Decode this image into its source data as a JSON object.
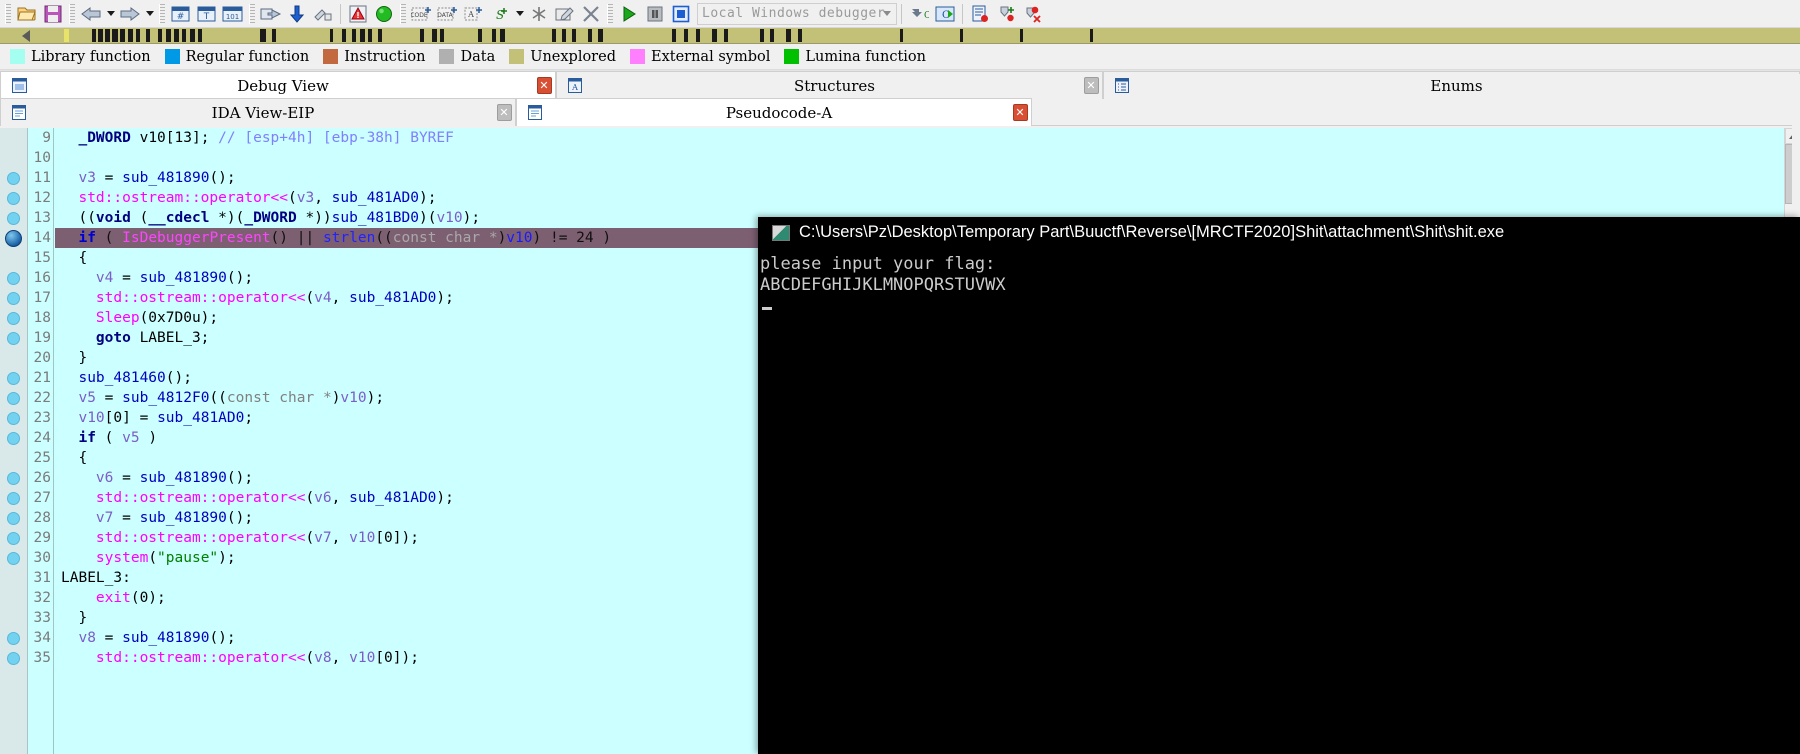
{
  "toolbar": {
    "debugger_combo_value": "Local Windows debugger",
    "buttons": [
      {
        "name": "open-file-icon",
        "glyph": "folder"
      },
      {
        "name": "save-icon",
        "glyph": "floppy"
      },
      {
        "name": "back-arrow-icon",
        "glyph": "left-arrow"
      },
      {
        "name": "back-history-dropdown-icon",
        "glyph": "caret"
      },
      {
        "name": "forward-arrow-icon",
        "glyph": "right-arrow"
      },
      {
        "name": "forward-history-dropdown-icon",
        "glyph": "caret"
      },
      {
        "name": "make-code-icon",
        "glyph": "code-hash"
      },
      {
        "name": "make-string-icon",
        "glyph": "text-T"
      },
      {
        "name": "make-data-icon",
        "glyph": "data-101"
      },
      {
        "name": "jump-to-operand-icon",
        "glyph": "jump"
      },
      {
        "name": "jump-down-icon",
        "glyph": "down-arrow"
      },
      {
        "name": "undefine-icon",
        "glyph": "undefine"
      },
      {
        "name": "warnings-icon",
        "glyph": "warning"
      },
      {
        "name": "run-icon",
        "glyph": "green-ball"
      },
      {
        "name": "add-code-icon",
        "glyph": "code-plus"
      },
      {
        "name": "add-data-icon",
        "glyph": "data-plus"
      },
      {
        "name": "add-ascii-icon",
        "glyph": "ascii-plus"
      },
      {
        "name": "add-struct-icon",
        "glyph": "struct-plus"
      },
      {
        "name": "struct-dropdown-icon",
        "glyph": "caret"
      },
      {
        "name": "unexplored-icon",
        "glyph": "asterisk"
      },
      {
        "name": "edit-icon",
        "glyph": "pencil-box"
      },
      {
        "name": "delete-icon",
        "glyph": "x-mark"
      },
      {
        "name": "debugger-start-icon",
        "glyph": "play"
      },
      {
        "name": "debugger-pause-icon",
        "glyph": "pause"
      },
      {
        "name": "debugger-stop-icon",
        "glyph": "stop"
      },
      {
        "name": "step-into-icon",
        "glyph": "step-into"
      },
      {
        "name": "step-over-icon",
        "glyph": "step-over"
      },
      {
        "name": "breakpoint-list-icon",
        "glyph": "bp-list"
      },
      {
        "name": "add-breakpoint-icon",
        "glyph": "bp-add"
      },
      {
        "name": "delete-breakpoint-icon",
        "glyph": "bp-del"
      }
    ]
  },
  "legend": {
    "items": [
      {
        "label": "Library function",
        "color": "#a5fff1"
      },
      {
        "label": "Regular function",
        "color": "#0099e6"
      },
      {
        "label": "Instruction",
        "color": "#c2693f"
      },
      {
        "label": "Data",
        "color": "#b0b0b0"
      },
      {
        "label": "Unexplored",
        "color": "#c3c177"
      },
      {
        "label": "External symbol",
        "color": "#ff7fff"
      },
      {
        "label": "Lumina function",
        "color": "#00c000"
      }
    ]
  },
  "tabs_top": [
    {
      "label": "Debug View",
      "active": true,
      "icon": "window-icon",
      "close": "red"
    },
    {
      "label": "Structures",
      "active": false,
      "icon": "struct-icon",
      "close": "grey"
    },
    {
      "label": "Enums",
      "active": false,
      "icon": "enum-icon",
      "close": "none"
    }
  ],
  "tabs_bottom": [
    {
      "label": "IDA View-EIP",
      "active": false,
      "icon": "page-icon",
      "close": "grey"
    },
    {
      "label": "Pseudocode-A",
      "active": true,
      "icon": "page-icon",
      "close": "red"
    }
  ],
  "code": {
    "highlighted_line": 14,
    "lines": [
      {
        "n": 9,
        "bp": false,
        "eip": false,
        "tokens": [
          {
            "t": "  ",
            "c": "plain"
          },
          {
            "t": "_DWORD",
            "c": "kw"
          },
          {
            "t": " v10[13]; ",
            "c": "plain"
          },
          {
            "t": "// [esp+4h] [ebp-38h] BYREF",
            "c": "cmt"
          }
        ]
      },
      {
        "n": 10,
        "bp": false,
        "eip": false,
        "tokens": []
      },
      {
        "n": 11,
        "bp": true,
        "eip": false,
        "tokens": [
          {
            "t": "  ",
            "c": "plain"
          },
          {
            "t": "v3",
            "c": "var"
          },
          {
            "t": " = ",
            "c": "plain"
          },
          {
            "t": "sub_481890",
            "c": "fn"
          },
          {
            "t": "();",
            "c": "plain"
          }
        ]
      },
      {
        "n": 12,
        "bp": true,
        "eip": false,
        "tokens": [
          {
            "t": "  ",
            "c": "plain"
          },
          {
            "t": "std::ostream::operator<<",
            "c": "api"
          },
          {
            "t": "(",
            "c": "plain"
          },
          {
            "t": "v3",
            "c": "var"
          },
          {
            "t": ", ",
            "c": "plain"
          },
          {
            "t": "sub_481AD0",
            "c": "fn"
          },
          {
            "t": ");",
            "c": "plain"
          }
        ]
      },
      {
        "n": 13,
        "bp": true,
        "eip": false,
        "tokens": [
          {
            "t": "  ((",
            "c": "plain"
          },
          {
            "t": "void",
            "c": "kw"
          },
          {
            "t": " (",
            "c": "plain"
          },
          {
            "t": "__cdecl",
            "c": "kw"
          },
          {
            "t": " *)(",
            "c": "plain"
          },
          {
            "t": "_DWORD",
            "c": "kw"
          },
          {
            "t": " *))",
            "c": "plain"
          },
          {
            "t": "sub_481BD0",
            "c": "fn"
          },
          {
            "t": ")(",
            "c": "plain"
          },
          {
            "t": "v10",
            "c": "var"
          },
          {
            "t": ");",
            "c": "plain"
          }
        ]
      },
      {
        "n": 14,
        "bp": false,
        "eip": true,
        "hl": true,
        "tokens": [
          {
            "t": "  ",
            "c": "plain"
          },
          {
            "t": "if",
            "c": "kw"
          },
          {
            "t": " ( ",
            "c": "plain"
          },
          {
            "t": "IsDebuggerPresent",
            "c": "api"
          },
          {
            "t": "() || ",
            "c": "plain"
          },
          {
            "t": "strlen",
            "c": "fn"
          },
          {
            "t": "((",
            "c": "plain"
          },
          {
            "t": "const char *",
            "c": "type"
          },
          {
            "t": ")",
            "c": "plain"
          },
          {
            "t": "v10",
            "c": "var"
          },
          {
            "t": ") != 24 )",
            "c": "plain"
          }
        ]
      },
      {
        "n": 15,
        "bp": false,
        "eip": false,
        "tokens": [
          {
            "t": "  {",
            "c": "plain"
          }
        ]
      },
      {
        "n": 16,
        "bp": true,
        "eip": false,
        "tokens": [
          {
            "t": "    ",
            "c": "plain"
          },
          {
            "t": "v4",
            "c": "var"
          },
          {
            "t": " = ",
            "c": "plain"
          },
          {
            "t": "sub_481890",
            "c": "fn"
          },
          {
            "t": "();",
            "c": "plain"
          }
        ]
      },
      {
        "n": 17,
        "bp": true,
        "eip": false,
        "tokens": [
          {
            "t": "    ",
            "c": "plain"
          },
          {
            "t": "std::ostream::operator<<",
            "c": "api"
          },
          {
            "t": "(",
            "c": "plain"
          },
          {
            "t": "v4",
            "c": "var"
          },
          {
            "t": ", ",
            "c": "plain"
          },
          {
            "t": "sub_481AD0",
            "c": "fn"
          },
          {
            "t": ");",
            "c": "plain"
          }
        ]
      },
      {
        "n": 18,
        "bp": true,
        "eip": false,
        "tokens": [
          {
            "t": "    ",
            "c": "plain"
          },
          {
            "t": "Sleep",
            "c": "api"
          },
          {
            "t": "(0x7D0u);",
            "c": "plain"
          }
        ]
      },
      {
        "n": 19,
        "bp": true,
        "eip": false,
        "tokens": [
          {
            "t": "    ",
            "c": "plain"
          },
          {
            "t": "goto",
            "c": "kw"
          },
          {
            "t": " LABEL_3;",
            "c": "plain"
          }
        ]
      },
      {
        "n": 20,
        "bp": false,
        "eip": false,
        "tokens": [
          {
            "t": "  }",
            "c": "plain"
          }
        ]
      },
      {
        "n": 21,
        "bp": true,
        "eip": false,
        "tokens": [
          {
            "t": "  ",
            "c": "plain"
          },
          {
            "t": "sub_481460",
            "c": "fn"
          },
          {
            "t": "();",
            "c": "plain"
          }
        ]
      },
      {
        "n": 22,
        "bp": true,
        "eip": false,
        "tokens": [
          {
            "t": "  ",
            "c": "plain"
          },
          {
            "t": "v5",
            "c": "var"
          },
          {
            "t": " = ",
            "c": "plain"
          },
          {
            "t": "sub_4812F0",
            "c": "fn"
          },
          {
            "t": "((",
            "c": "plain"
          },
          {
            "t": "const char *",
            "c": "type"
          },
          {
            "t": ")",
            "c": "plain"
          },
          {
            "t": "v10",
            "c": "var"
          },
          {
            "t": ");",
            "c": "plain"
          }
        ]
      },
      {
        "n": 23,
        "bp": true,
        "eip": false,
        "tokens": [
          {
            "t": "  ",
            "c": "plain"
          },
          {
            "t": "v10",
            "c": "var"
          },
          {
            "t": "[0] = ",
            "c": "plain"
          },
          {
            "t": "sub_481AD0",
            "c": "fn"
          },
          {
            "t": ";",
            "c": "plain"
          }
        ]
      },
      {
        "n": 24,
        "bp": true,
        "eip": false,
        "tokens": [
          {
            "t": "  ",
            "c": "plain"
          },
          {
            "t": "if",
            "c": "kw"
          },
          {
            "t": " ( ",
            "c": "plain"
          },
          {
            "t": "v5",
            "c": "var"
          },
          {
            "t": " )",
            "c": "plain"
          }
        ]
      },
      {
        "n": 25,
        "bp": false,
        "eip": false,
        "tokens": [
          {
            "t": "  {",
            "c": "plain"
          }
        ]
      },
      {
        "n": 26,
        "bp": true,
        "eip": false,
        "tokens": [
          {
            "t": "    ",
            "c": "plain"
          },
          {
            "t": "v6",
            "c": "var"
          },
          {
            "t": " = ",
            "c": "plain"
          },
          {
            "t": "sub_481890",
            "c": "fn"
          },
          {
            "t": "();",
            "c": "plain"
          }
        ]
      },
      {
        "n": 27,
        "bp": true,
        "eip": false,
        "tokens": [
          {
            "t": "    ",
            "c": "plain"
          },
          {
            "t": "std::ostream::operator<<",
            "c": "api"
          },
          {
            "t": "(",
            "c": "plain"
          },
          {
            "t": "v6",
            "c": "var"
          },
          {
            "t": ", ",
            "c": "plain"
          },
          {
            "t": "sub_481AD0",
            "c": "fn"
          },
          {
            "t": ");",
            "c": "plain"
          }
        ]
      },
      {
        "n": 28,
        "bp": true,
        "eip": false,
        "tokens": [
          {
            "t": "    ",
            "c": "plain"
          },
          {
            "t": "v7",
            "c": "var"
          },
          {
            "t": " = ",
            "c": "plain"
          },
          {
            "t": "sub_481890",
            "c": "fn"
          },
          {
            "t": "();",
            "c": "plain"
          }
        ]
      },
      {
        "n": 29,
        "bp": true,
        "eip": false,
        "tokens": [
          {
            "t": "    ",
            "c": "plain"
          },
          {
            "t": "std::ostream::operator<<",
            "c": "api"
          },
          {
            "t": "(",
            "c": "plain"
          },
          {
            "t": "v7",
            "c": "var"
          },
          {
            "t": ", ",
            "c": "plain"
          },
          {
            "t": "v10",
            "c": "var"
          },
          {
            "t": "[0]);",
            "c": "plain"
          }
        ]
      },
      {
        "n": 30,
        "bp": true,
        "eip": false,
        "tokens": [
          {
            "t": "    ",
            "c": "plain"
          },
          {
            "t": "system",
            "c": "api"
          },
          {
            "t": "(",
            "c": "plain"
          },
          {
            "t": "\"pause\"",
            "c": "str"
          },
          {
            "t": ");",
            "c": "plain"
          }
        ]
      },
      {
        "n": 31,
        "bp": false,
        "eip": false,
        "tokens": [
          {
            "t": "LABEL_3:",
            "c": "plain"
          }
        ]
      },
      {
        "n": 32,
        "bp": false,
        "eip": false,
        "tokens": [
          {
            "t": "    ",
            "c": "plain"
          },
          {
            "t": "exit",
            "c": "api"
          },
          {
            "t": "(0);",
            "c": "plain"
          }
        ]
      },
      {
        "n": 33,
        "bp": false,
        "eip": false,
        "tokens": [
          {
            "t": "  }",
            "c": "plain"
          }
        ]
      },
      {
        "n": 34,
        "bp": true,
        "eip": false,
        "tokens": [
          {
            "t": "  ",
            "c": "plain"
          },
          {
            "t": "v8",
            "c": "var"
          },
          {
            "t": " = ",
            "c": "plain"
          },
          {
            "t": "sub_481890",
            "c": "fn"
          },
          {
            "t": "();",
            "c": "plain"
          }
        ]
      },
      {
        "n": 35,
        "bp": true,
        "eip": false,
        "tokens": [
          {
            "t": "    ",
            "c": "plain"
          },
          {
            "t": "std::ostream::operator<<",
            "c": "api"
          },
          {
            "t": "(",
            "c": "plain"
          },
          {
            "t": "v8",
            "c": "var"
          },
          {
            "t": ", ",
            "c": "plain"
          },
          {
            "t": "v10",
            "c": "var"
          },
          {
            "t": "[0]);",
            "c": "plain"
          }
        ]
      }
    ]
  },
  "console": {
    "title": "C:\\Users\\Pz\\Desktop\\Temporary Part\\Buuctf\\Reverse\\[MRCTF2020]Shit\\attachment\\Shit\\shit.exe",
    "output_line1": "please input your flag:",
    "output_line2": "ABCDEFGHIJKLMNOPQRSTUVWX"
  },
  "colors": {
    "code_bg": "#ccffff",
    "highlight_row": "#7d5f72",
    "unexplored": "#c3c177",
    "breakpoint": "#73d2f0"
  }
}
